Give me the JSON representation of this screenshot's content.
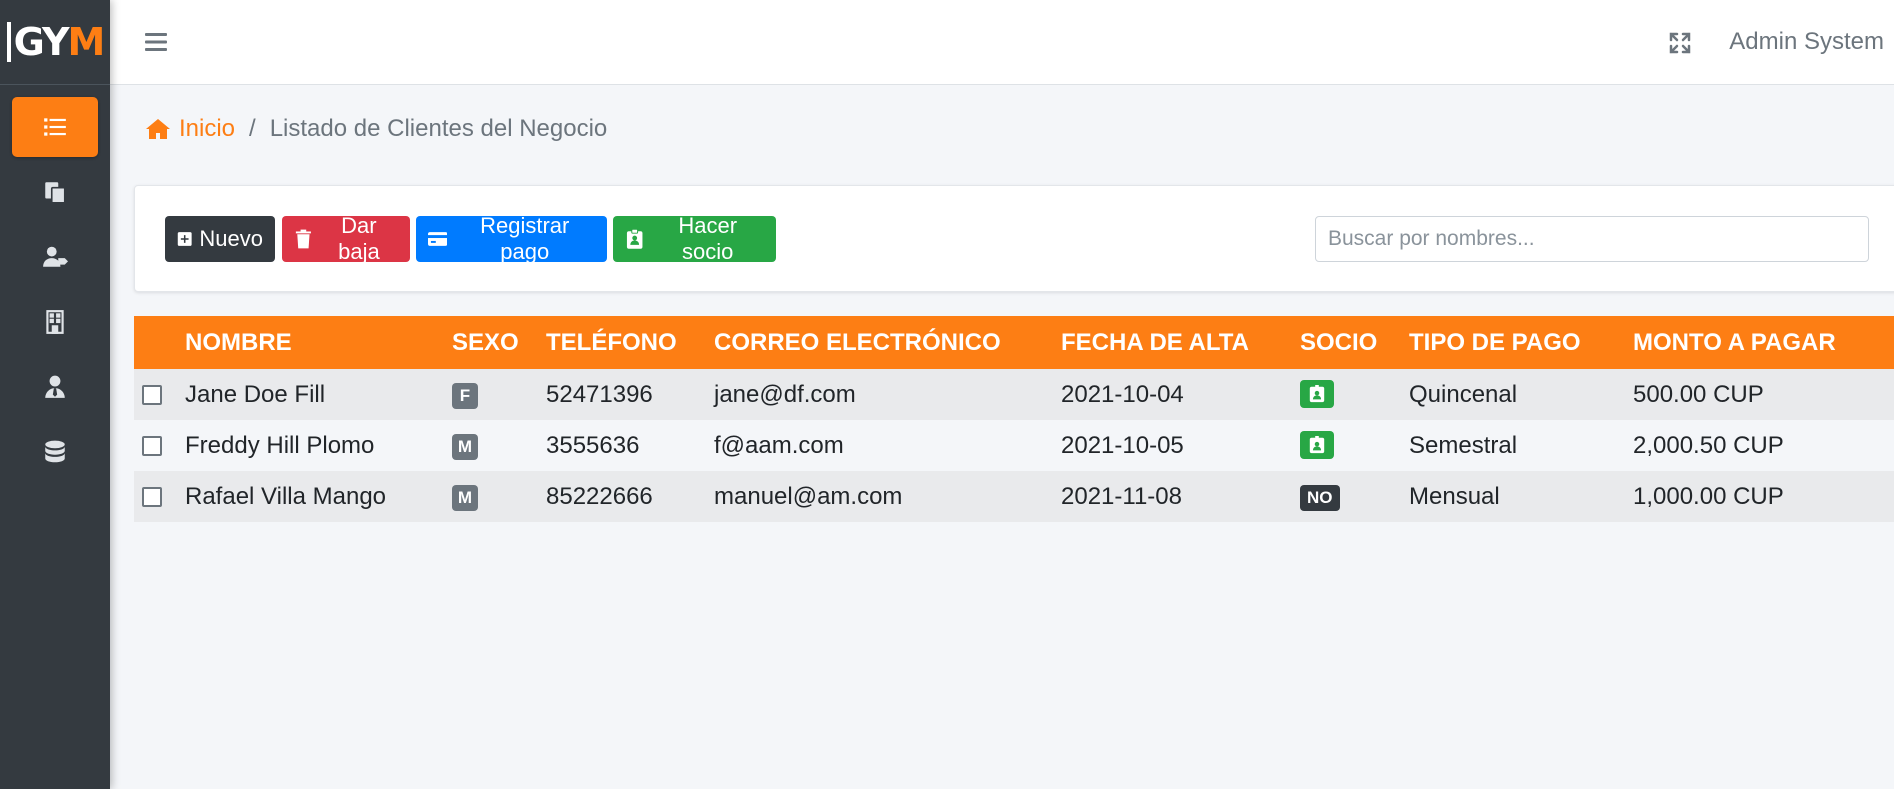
{
  "app": {
    "logo_text": "GYM",
    "user": "Admin System"
  },
  "colors": {
    "accent": "#fd7e14",
    "sidebar": "#343a40",
    "danger": "#dc3545",
    "primary": "#007bff",
    "success": "#28a745"
  },
  "sidebar": {
    "items": [
      {
        "icon": "list-icon",
        "active": true
      },
      {
        "icon": "copy-icon",
        "active": false
      },
      {
        "icon": "user-tag-icon",
        "active": false
      },
      {
        "icon": "building-icon",
        "active": false
      },
      {
        "icon": "user-tie-icon",
        "active": false
      },
      {
        "icon": "database-icon",
        "active": false
      }
    ]
  },
  "breadcrumb": {
    "home": "Inicio",
    "separator": "/",
    "current": "Listado de Clientes del Negocio"
  },
  "toolbar": {
    "new_label": "Nuevo",
    "remove_label": "Dar baja",
    "pay_label": "Registrar pago",
    "member_label": "Hacer socio",
    "search_placeholder": "Buscar por nombres..."
  },
  "table": {
    "headers": [
      "NOMBRE",
      "SEXO",
      "TELÉFONO",
      "CORREO ELECTRÓNICO",
      "FECHA DE ALTA",
      "SOCIO",
      "TIPO DE PAGO",
      "MONTO A PAGAR"
    ],
    "rows": [
      {
        "nombre": "Jane Doe Fill",
        "sexo": "F",
        "telefono": "52471396",
        "correo": "jane@df.com",
        "fecha": "2021-10-04",
        "socio": "id-card-icon",
        "tipo": "Quincenal",
        "monto": "500.00 CUP"
      },
      {
        "nombre": "Freddy Hill Plomo",
        "sexo": "M",
        "telefono": "3555636",
        "correo": "f@aam.com",
        "fecha": "2021-10-05",
        "socio": "id-card-icon",
        "tipo": "Semestral",
        "monto": "2,000.50 CUP"
      },
      {
        "nombre": "Rafael Villa Mango",
        "sexo": "M",
        "telefono": "85222666",
        "correo": "manuel@am.com",
        "fecha": "2021-11-08",
        "socio": "NO",
        "tipo": "Mensual",
        "monto": "1,000.00 CUP"
      }
    ]
  }
}
